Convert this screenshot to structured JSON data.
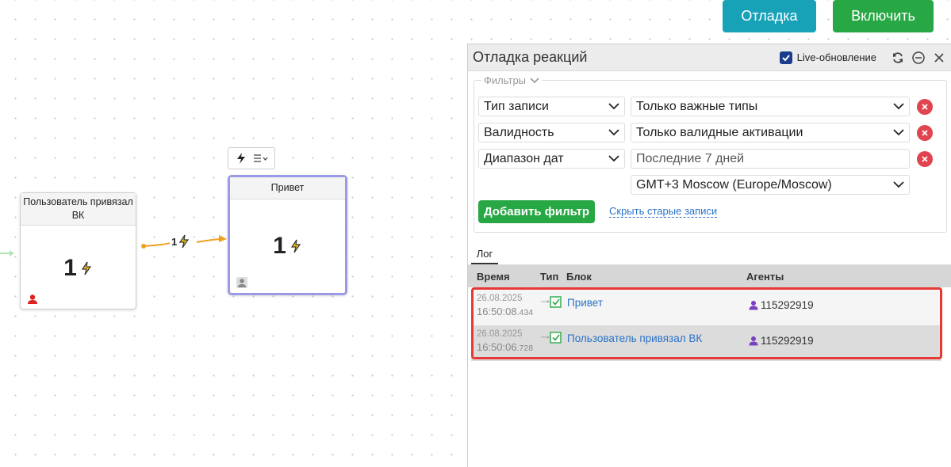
{
  "top_buttons": {
    "debug": "Отладка",
    "enable": "Включить"
  },
  "canvas": {
    "nodes": [
      {
        "title": "Пользователь привязал ВК",
        "count": "1"
      },
      {
        "title": "Привет",
        "count": "1"
      }
    ],
    "edge_count": "1"
  },
  "panel": {
    "title": "Отладка реакций",
    "live_label": "Live-обновление",
    "filters_label": "Фильтры",
    "filters": [
      {
        "field": "Тип записи",
        "value": "Только важные типы",
        "placeholder": false
      },
      {
        "field": "Валидность",
        "value": "Только валидные активации",
        "placeholder": false
      },
      {
        "field": "Диапазон дат",
        "value": "Последние 7 дней",
        "placeholder": true
      }
    ],
    "timezone": "GMT+3 Moscow (Europe/Moscow)",
    "add_filter": "Добавить фильтр",
    "hide_old": "Скрыть старые записи",
    "tab_log": "Лог",
    "columns": {
      "time": "Время",
      "type": "Тип",
      "block": "Блок",
      "agents": "Агенты"
    },
    "rows": [
      {
        "date": "26.08.2025",
        "time": "16:50:08",
        "ms": ".434",
        "block": "Привет",
        "agent": "115292919"
      },
      {
        "date": "26.08.2025",
        "time": "16:50:06",
        "ms": ".728",
        "block": "Пользователь привязал ВК",
        "agent": "115292919"
      }
    ]
  },
  "colors": {
    "accent_debug": "#17a2b8",
    "accent_enable": "#28a745",
    "remove": "#e0454f",
    "highlight": "#e53935",
    "link": "#2a73c9"
  }
}
